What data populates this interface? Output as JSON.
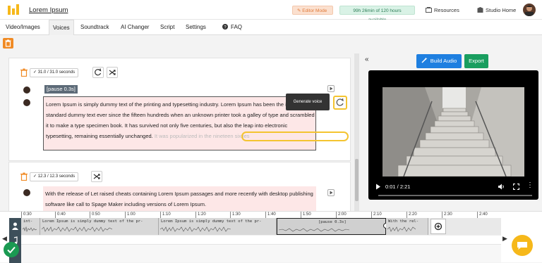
{
  "header": {
    "app_title": "Lorem Ipsum",
    "editor_mode": "✎ Editor Mode",
    "hours_available": "99h 26min of 120 hours available",
    "resources": "Resources",
    "studio_home": "Studio Home"
  },
  "nav": {
    "tabs": [
      "Video/Images",
      "Voices",
      "Soundtrack",
      "AI Changer",
      "Script",
      "Settings",
      "FAQ"
    ],
    "active_tab": "Voices"
  },
  "cards": [
    {
      "duration": "31.0 / 31.0 seconds",
      "pause_tag": "[pause 0.3s]",
      "paragraph_main": "Lorem Ipsum is simply dummy text of the printing and typesetting industry. Lorem Ipsum has been the industry 's standard dummy text ever since the fifteen hundreds when an unknown printer took a galley of type and scrambled it to make a type specimen book. It has survived not only five centuries, but also the leap into electronic typesetting, remaining essentially unchanged. ",
      "paragraph_highlight": "It was popularized in the nineteen sixties",
      "tooltip": "Generate voice"
    },
    {
      "duration": "12.3 / 12.3 seconds",
      "paragraph": "With the release of Let raised cheats containing Lorem Ipsum passages and more recently with desktop publishing software like call to Spage Maker including versions of Lorem Ipsum."
    }
  ],
  "right": {
    "build_audio": "Build Audio",
    "export": "Export",
    "video_time": "0:01 / 2:21"
  },
  "timeline": {
    "ticks": [
      "0:30",
      "0:40",
      "0:50",
      "1:00",
      "1:10",
      "1:20",
      "1:30",
      "1:40",
      "1:50",
      "2:00",
      "2:10",
      "2:20",
      "2:30",
      "2:40"
    ],
    "segments": [
      {
        "label": "int-"
      },
      {
        "label": "Lorem Ipsum is simply dummy text of the pr-"
      },
      {
        "label": "Lorem Ipsum is simply dummy text of the pr-"
      },
      {
        "label": "[pause 0.3s]"
      },
      {
        "label": "With the rel-"
      }
    ]
  },
  "colors": {
    "accent_blue": "#1e7fe0",
    "accent_green": "#199e5f",
    "accent_orange": "#f08a24",
    "highlight_yellow": "#f4c430",
    "pink_bg": "#fde7e7"
  }
}
